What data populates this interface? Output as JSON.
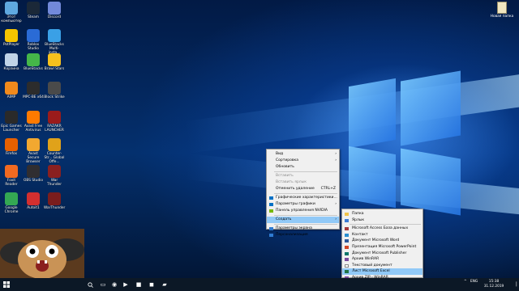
{
  "colors": {
    "taskbar": "#0c1826",
    "menu_bg": "#f0f0f0",
    "menu_hover": "#91c9f7",
    "wallpaper_glow": "#5aaaff"
  },
  "desktop_icons": [
    {
      "label": "Этот компьютер",
      "icon": "computer-icon",
      "color": "#5fa8e0"
    },
    {
      "label": "Steam",
      "icon": "steam-icon",
      "color": "#1b2838"
    },
    {
      "label": "Discord",
      "icon": "discord-icon",
      "color": "#7289da"
    },
    {
      "label": "PotPlayer",
      "icon": "potplayer-icon",
      "color": "#f5c400"
    },
    {
      "label": "Roblox Studio",
      "icon": "roblox-studio-icon",
      "color": "#2a6bd6"
    },
    {
      "label": "BlueStacks Multi-insta...",
      "icon": "bluestacks-multi-icon",
      "color": "#3aa0e6"
    },
    {
      "label": "Корзина",
      "icon": "recycle-bin-icon",
      "color": "#c0d4e8"
    },
    {
      "label": "BlueStacks",
      "icon": "bluestacks-icon",
      "color": "#45b649"
    },
    {
      "label": "Brawl Stars",
      "icon": "brawl-stars-icon",
      "color": "#f7c11d"
    },
    {
      "label": "AIMP",
      "icon": "aimp-icon",
      "color": "#f28a1c"
    },
    {
      "label": "MPC-BE x64",
      "icon": "mpc-be-icon",
      "color": "#2c2c2c"
    },
    {
      "label": "Block Strike",
      "icon": "block-strike-icon",
      "color": "#4a4a4a"
    },
    {
      "label": "Epic Games Launcher",
      "icon": "epic-games-icon",
      "color": "#2a2a2a"
    },
    {
      "label": "Avast Free Antivirus",
      "icon": "avast-icon",
      "color": "#ff7a00"
    },
    {
      "label": "RAZAKR LAUNCHER",
      "icon": "razakr-launcher-icon",
      "color": "#9a1b1b"
    },
    {
      "label": "Firefox",
      "icon": "firefox-icon",
      "color": "#e66000"
    },
    {
      "label": "Avast Secure Browser",
      "icon": "avast-secure-browser-icon",
      "color": "#f2a830"
    },
    {
      "label": "Counter-Str... Global Offe...",
      "icon": "csgo-icon",
      "color": "#e0a21a"
    },
    {
      "label": "Foxit Reader",
      "icon": "foxit-reader-icon",
      "color": "#f26a21"
    },
    {
      "label": "OBS Studio",
      "icon": "obs-studio-icon",
      "color": "#302e31"
    },
    {
      "label": "War Thunder",
      "icon": "war-thunder-icon",
      "color": "#8a2020"
    },
    {
      "label": "Google Chrome",
      "icon": "chrome-icon",
      "color": "#34a853"
    },
    {
      "label": "Autoit1",
      "icon": "autoit-icon",
      "color": "#d32f2f"
    },
    {
      "label": "WarThunder",
      "icon": "warthunder-icon",
      "color": "#7a1d1d"
    }
  ],
  "desktop_right_icon": {
    "label": "Новая папка",
    "icon": "folder-icon"
  },
  "context_menu": {
    "items": [
      {
        "label": "Вид",
        "arrow": "›"
      },
      {
        "label": "Сортировка",
        "arrow": "›"
      },
      {
        "label": "Обновить"
      },
      {
        "sep": true
      },
      {
        "label": "Вставить",
        "disabled": true
      },
      {
        "label": "Вставить ярлык",
        "disabled": true
      },
      {
        "label": "Отменить удаление",
        "shortcut": "CTRL+Z"
      },
      {
        "sep": true
      },
      {
        "label": "Графические характеристики...",
        "icon": "intel-graphics-icon",
        "color": "#0071c5"
      },
      {
        "label": "Параметры графики",
        "arrow": "›",
        "icon": "intel-graphics-icon",
        "color": "#0071c5"
      },
      {
        "label": "Панель управления NVIDIA",
        "icon": "nvidia-icon",
        "color": "#76b900"
      },
      {
        "sep": true
      },
      {
        "label": "Создать",
        "arrow": "›",
        "hover": true
      },
      {
        "sep": true
      },
      {
        "label": "Параметры экрана",
        "icon": "display-settings-icon",
        "color": "#2f7bd1"
      },
      {
        "label": "Персонализация",
        "icon": "personalization-icon",
        "color": "#2f7bd1"
      }
    ]
  },
  "submenu": {
    "items": [
      {
        "label": "Папка",
        "icon": "folder-icon",
        "color": "#f0c44c"
      },
      {
        "label": "Ярлык",
        "icon": "shortcut-icon",
        "color": "#3b7bd6"
      },
      {
        "sep": true
      },
      {
        "label": "Microsoft Access База данных",
        "icon": "access-icon",
        "color": "#a4373a"
      },
      {
        "label": "Контакт",
        "icon": "contact-icon",
        "color": "#2a8fd0"
      },
      {
        "label": "Документ Microsoft Word",
        "icon": "word-icon",
        "color": "#2b579a"
      },
      {
        "label": "Презентация Microsoft PowerPoint",
        "icon": "powerpoint-icon",
        "color": "#d24726"
      },
      {
        "label": "Документ Microsoft Publisher",
        "icon": "publisher-icon",
        "color": "#077568"
      },
      {
        "label": "Архив WinRAR",
        "icon": "winrar-icon",
        "color": "#7b4a9c"
      },
      {
        "label": "Текстовый документ",
        "icon": "text-document-icon",
        "color": "#ffffff"
      },
      {
        "label": "Лист Microsoft Excel",
        "icon": "excel-icon",
        "color": "#217346",
        "hover": true
      },
      {
        "label": "Архив ZIP - WinRAR",
        "icon": "zip-icon",
        "color": "#7b4a9c"
      }
    ]
  },
  "taskbar": {
    "start_icon": "windows-start-icon",
    "search_icon": "search-icon",
    "pinned": [
      {
        "icon": "task-view-icon",
        "glyph": "▭"
      },
      {
        "icon": "obs-taskbar-icon",
        "glyph": "◉"
      },
      {
        "icon": "media-player-icon",
        "glyph": "▶"
      },
      {
        "icon": "app-taskbar-icon",
        "glyph": "■"
      },
      {
        "icon": "recording-icon",
        "glyph": "◼"
      },
      {
        "icon": "explorer-icon",
        "glyph": "▰"
      }
    ],
    "tray": {
      "chevron": "^",
      "lang": "ENG",
      "time": "15:38",
      "date": "31.12.2019"
    }
  }
}
